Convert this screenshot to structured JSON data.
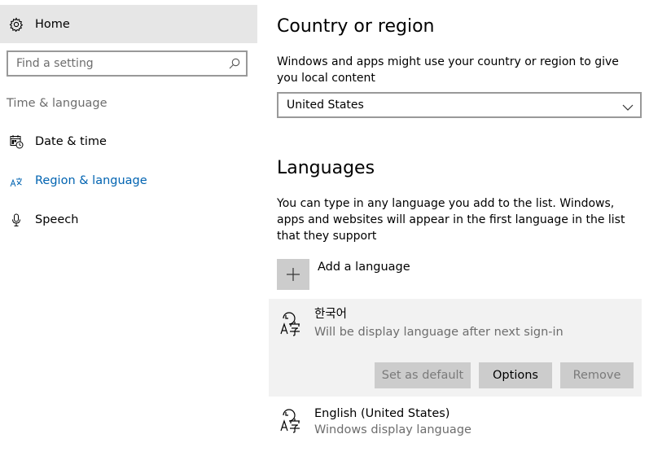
{
  "sidebar": {
    "home_label": "Home",
    "search": {
      "placeholder": "Find a setting",
      "value": ""
    },
    "section_title": "Time & language",
    "items": [
      {
        "label": "Date & time",
        "icon": "calendar-clock-icon",
        "active": false
      },
      {
        "label": "Region & language",
        "icon": "region-language-icon",
        "active": true
      },
      {
        "label": "Speech",
        "icon": "microphone-icon",
        "active": false
      }
    ]
  },
  "main": {
    "country": {
      "title": "Country or region",
      "description": "Windows and apps might use your country or region to give you local content",
      "selected": "United States"
    },
    "languages": {
      "title": "Languages",
      "description": "You can type in any language you add to the list. Windows, apps and websites will appear in the first language in the list that they support",
      "add_label": "Add a language",
      "list": [
        {
          "name": "한국어",
          "subtitle": "Will be display language after next sign-in",
          "selected": true,
          "buttons": {
            "set_default": "Set as default",
            "options": "Options",
            "remove": "Remove"
          }
        },
        {
          "name": "English (United States)",
          "subtitle": "Windows display language",
          "selected": false
        }
      ]
    }
  },
  "colors": {
    "accent": "#0063b1",
    "sidebar_selected_bg": "#e6e6e6",
    "card_selected_bg": "#f2f2f2",
    "button_bg": "#cccccc",
    "secondary_text": "#6d6d6d"
  }
}
